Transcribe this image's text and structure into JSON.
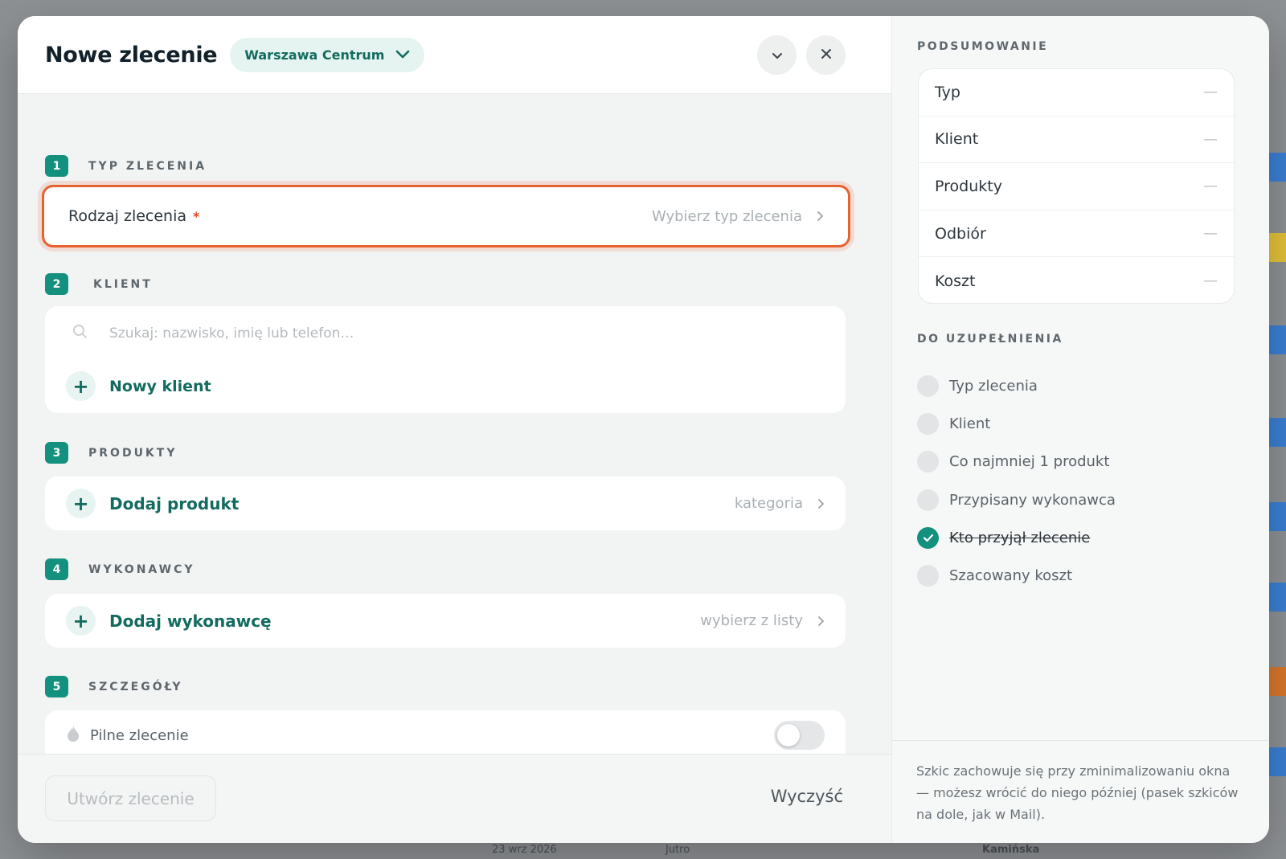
{
  "header": {
    "title": "Nowe zlecenie",
    "location": "Warszawa Centrum"
  },
  "sections": {
    "type": {
      "number": "1",
      "label": "TYP ZLECENIA",
      "field_label": "Rodzaj zlecenia",
      "required_mark": "*",
      "placeholder": "Wybierz typ zlecenia"
    },
    "client": {
      "number": "2",
      "label": "KLIENT",
      "search_placeholder": "Szukaj: nazwisko, imię lub telefon…",
      "new_client": "Nowy klient"
    },
    "products": {
      "number": "3",
      "label": "PRODUKTY",
      "add": "Dodaj produkt",
      "hint": "kategoria"
    },
    "contractors": {
      "number": "4",
      "label": "WYKONAWCY",
      "add": "Dodaj wykonawcę",
      "hint": "wybierz z listy"
    },
    "details": {
      "number": "5",
      "label": "SZCZEGÓŁY",
      "urgent": "Pilne zlecenie",
      "urgent_on": false
    }
  },
  "footer": {
    "create": "Utwórz zlecenie",
    "clear": "Wyczyść"
  },
  "summary": {
    "heading": "PODSUMOWANIE",
    "rows": [
      {
        "label": "Typ",
        "value": "—"
      },
      {
        "label": "Klient",
        "value": "—"
      },
      {
        "label": "Produkty",
        "value": "—"
      },
      {
        "label": "Odbiór",
        "value": "—"
      },
      {
        "label": "Koszt",
        "value": "—"
      }
    ]
  },
  "todo": {
    "heading": "DO UZUPEŁNIENIA",
    "items": [
      {
        "label": "Typ zlecenia",
        "done": false
      },
      {
        "label": "Klient",
        "done": false
      },
      {
        "label": "Co najmniej 1 produkt",
        "done": false
      },
      {
        "label": "Przypisany wykonawca",
        "done": false
      },
      {
        "label": "Kto przyjął zlecenie",
        "done": true
      },
      {
        "label": "Szacowany koszt",
        "done": false
      }
    ]
  },
  "draft_note": "Szkic zachowuje się przy zminimalizowaniu okna — możesz wrócić do niego później (pasek szkiców na dole, jak w Mail).",
  "backdrop": {
    "date_text": "23 wrz 2026",
    "day_text": "Jutro",
    "name_text": "Kamińska"
  },
  "colors": {
    "accent": "#14907e",
    "accent_text": "#136b5f",
    "highlight": "#e8622f",
    "required": "#e0472a"
  }
}
